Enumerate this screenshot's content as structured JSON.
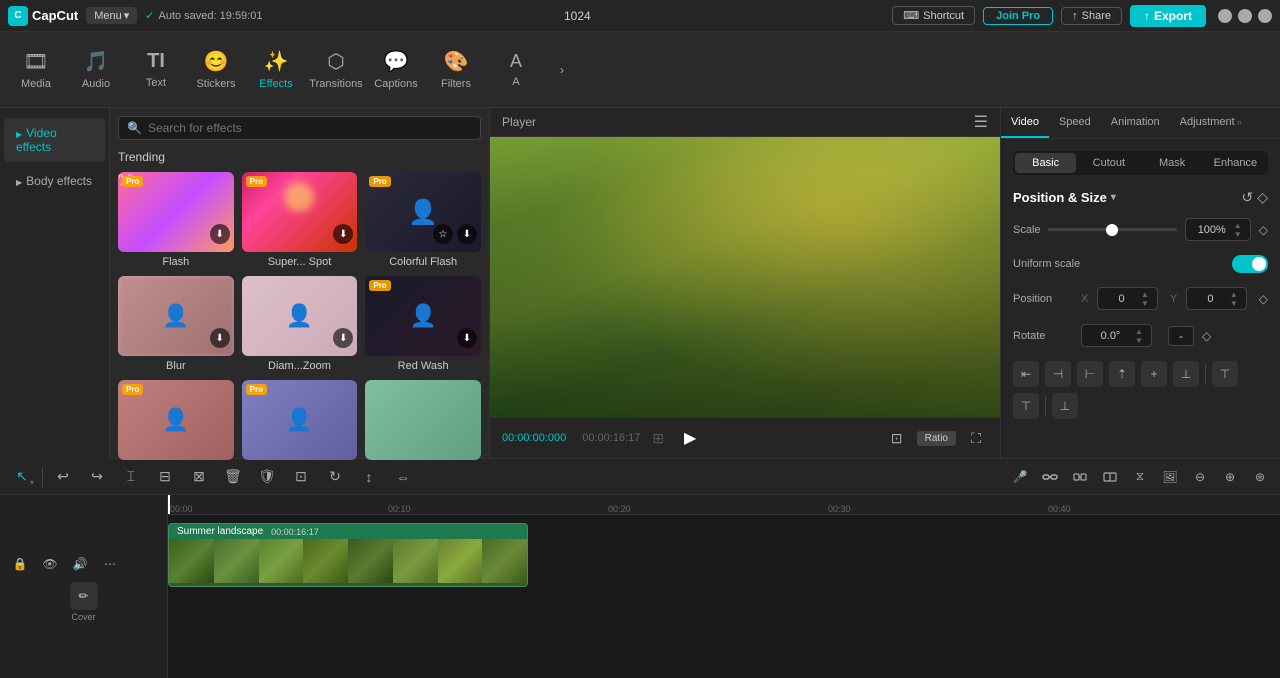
{
  "app": {
    "name": "CapCut",
    "logo_text": "C"
  },
  "topbar": {
    "menu_label": "Menu",
    "menu_arrow": "▾",
    "autosave_text": "Auto saved: 19:59:01",
    "project_number": "1024",
    "shortcut_label": "Shortcut",
    "join_pro_label": "Join Pro",
    "share_label": "Share",
    "export_label": "Export",
    "minimize": "—",
    "maximize": "□",
    "close": "✕"
  },
  "toolbar": {
    "items": [
      {
        "id": "media",
        "icon": "🎞",
        "label": "Media"
      },
      {
        "id": "audio",
        "icon": "🎵",
        "label": "Audio"
      },
      {
        "id": "text",
        "icon": "T",
        "label": "Text"
      },
      {
        "id": "stickers",
        "icon": "😊",
        "label": "Stickers"
      },
      {
        "id": "effects",
        "icon": "✨",
        "label": "Effects"
      },
      {
        "id": "transitions",
        "icon": "⬡",
        "label": "Transitions"
      },
      {
        "id": "captions",
        "icon": "💬",
        "label": "Captions"
      },
      {
        "id": "filters",
        "icon": "🎨",
        "label": "Filters"
      },
      {
        "id": "more",
        "icon": "A",
        "label": "A"
      }
    ],
    "more_icon": "›"
  },
  "effects_panel": {
    "search_placeholder": "Search for effects",
    "video_effects_label": "Video effects",
    "body_effects_label": "Body effects",
    "trending_label": "Trending",
    "effects": [
      {
        "id": "flash",
        "name": "Flash",
        "pro": true,
        "class": "eff-flash",
        "has_download": true,
        "has_star": false
      },
      {
        "id": "super_spot",
        "name": "Super... Spot",
        "pro": true,
        "class": "eff-spot",
        "has_download": true,
        "has_star": false
      },
      {
        "id": "colorful_flash",
        "name": "Colorful Flash",
        "pro": true,
        "class": "eff-colorflash",
        "has_download": true,
        "has_star": true
      },
      {
        "id": "blur",
        "name": "Blur",
        "pro": false,
        "class": "eff-blur",
        "has_download": true,
        "has_star": false
      },
      {
        "id": "diam_zoom",
        "name": "Diam...Zoom",
        "pro": false,
        "class": "eff-diamzoom",
        "has_download": true,
        "has_star": false
      },
      {
        "id": "red_wash",
        "name": "Red Wash",
        "pro": true,
        "class": "eff-redwash",
        "has_download": true,
        "has_star": false
      },
      {
        "id": "pro3",
        "name": "",
        "pro": true,
        "class": "eff-pro3",
        "has_download": false,
        "has_star": false
      },
      {
        "id": "pro4",
        "name": "",
        "pro": true,
        "class": "eff-pro4",
        "has_download": false,
        "has_star": false
      },
      {
        "id": "pro5",
        "name": "",
        "pro": false,
        "class": "eff-pro5",
        "has_download": false,
        "has_star": false
      }
    ],
    "pro_badge_text": "Pro"
  },
  "player": {
    "title": "Player",
    "time_current": "00:00:00:000",
    "time_total": "00:00:16:17",
    "ratio_label": "Ratio"
  },
  "right_panel": {
    "tabs": [
      "Video",
      "Speed",
      "Animation",
      "Adjustment"
    ],
    "active_tab": "Video",
    "subtabs": [
      "Basic",
      "Cutout",
      "Mask",
      "Enhance"
    ],
    "active_subtab": "Basic",
    "section_title": "Position & Size",
    "scale_label": "Scale",
    "scale_value": "100%",
    "uniform_scale_label": "Uniform scale",
    "uniform_scale_on": true,
    "position_label": "Position",
    "pos_x_label": "X",
    "pos_x_value": "0",
    "pos_y_label": "Y",
    "pos_y_value": "0",
    "rotate_label": "Rotate",
    "rotate_value": "0.0°",
    "rotate_symbol": "-",
    "align_buttons": [
      "⇤",
      "⊣",
      "⊢",
      "⇡",
      "+",
      "⊥",
      "⊤",
      "⊦",
      "⊧"
    ]
  },
  "timeline": {
    "tools": [
      {
        "id": "select",
        "icon": "↖",
        "active": true
      },
      {
        "id": "undo",
        "icon": "↩"
      },
      {
        "id": "redo",
        "icon": "↪"
      },
      {
        "id": "split",
        "icon": "⌘"
      },
      {
        "id": "split2",
        "icon": "⊟"
      },
      {
        "id": "trim",
        "icon": "⊠"
      },
      {
        "id": "delete",
        "icon": "🗑"
      },
      {
        "id": "protect",
        "icon": "🛡"
      },
      {
        "id": "crop",
        "icon": "⊡"
      },
      {
        "id": "loop",
        "icon": "↻"
      },
      {
        "id": "flip",
        "icon": "↕"
      },
      {
        "id": "mirror",
        "icon": "⇔"
      }
    ],
    "right_tools": [
      {
        "id": "mic",
        "icon": "🎤"
      },
      {
        "id": "clip1",
        "icon": "🔗"
      },
      {
        "id": "clip2",
        "icon": "🔗"
      },
      {
        "id": "clip3",
        "icon": "🔗"
      },
      {
        "id": "link",
        "icon": "⧖"
      },
      {
        "id": "image",
        "icon": "🖼"
      },
      {
        "id": "minus",
        "icon": "⊖"
      },
      {
        "id": "plus",
        "icon": "⊕"
      },
      {
        "id": "zoom",
        "icon": "⊛"
      }
    ],
    "ruler_marks": [
      "00:00",
      "00:10",
      "00:20",
      "00:30",
      "00:40"
    ],
    "clip": {
      "name": "Summer landscape",
      "duration": "00:00:16:17"
    },
    "cover_label": "Cover",
    "sidebar_icons": [
      "🔒",
      "👁",
      "🔊",
      "⋯"
    ]
  }
}
